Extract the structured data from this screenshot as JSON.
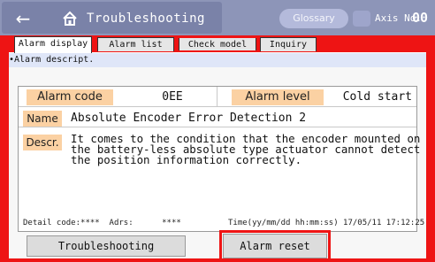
{
  "header": {
    "back_icon": "arrow-left-icon",
    "home_icon": "home-icon",
    "title": "Troubleshooting",
    "glossary_label": "Glossary",
    "axis_icon": "axis-icon",
    "axis_label": "Axis No.",
    "axis_number": "00"
  },
  "tabs": [
    {
      "label": "Alarm display",
      "active": true
    },
    {
      "label": "Alarm list",
      "active": false
    },
    {
      "label": "Check model num.",
      "active": false
    },
    {
      "label": "Inquiry",
      "active": false
    }
  ],
  "section": {
    "title": "•Alarm descript."
  },
  "alarm": {
    "code_label": "Alarm code",
    "code_value": "0EE",
    "level_label": "Alarm level",
    "level_value": "Cold start",
    "name_label": "Name",
    "name_value": "Absolute Encoder Error Detection 2",
    "descr_label": "Descr.",
    "descr_lines": [
      "It comes to the condition that the encoder mounted on",
      "the battery-less absolute type actuator cannot detect",
      "the position information correctly."
    ]
  },
  "footer": {
    "detail_text": "Detail code:****  Adrs:      ****",
    "time_text": "Time(yy/mm/dd hh:mm:ss) 17/05/11 17:12:25"
  },
  "buttons": {
    "troubleshooting": "Troubleshooting",
    "alarm_reset": "Alarm reset"
  },
  "colors": {
    "highlight": "#ee1414",
    "header": "#8d95b8",
    "label_bg": "#fbd1a3"
  }
}
